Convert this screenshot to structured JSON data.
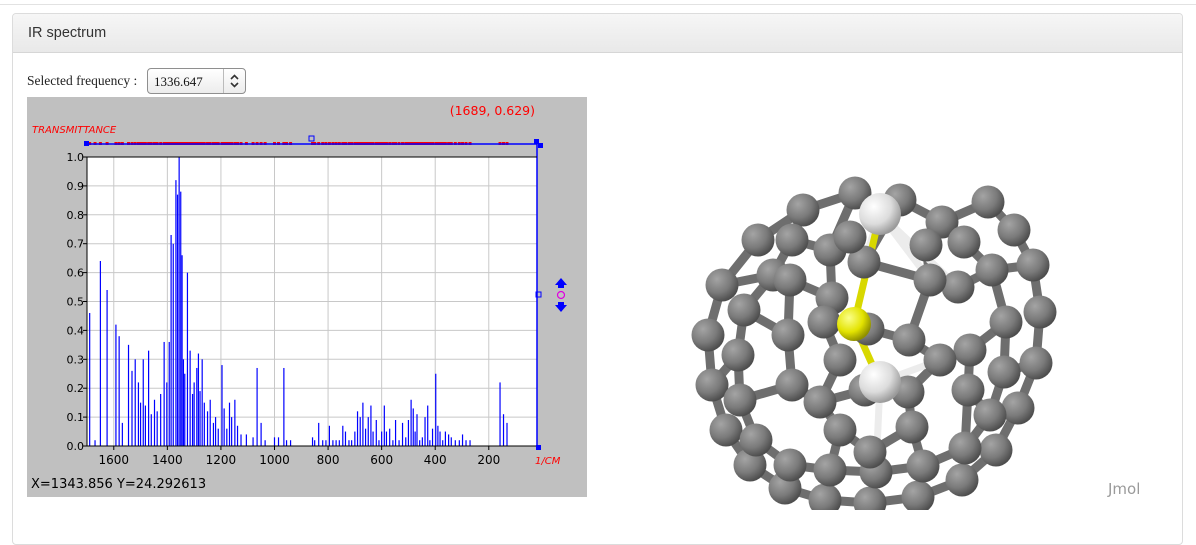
{
  "panel": {
    "title": "IR spectrum"
  },
  "frequency": {
    "label": "Selected frequency :",
    "value": "1336.647"
  },
  "spectrum": {
    "cursor_readout": "(1689, 0.629)",
    "status_readout": "X=1343.856 Y=24.292613",
    "x_unit": "1/CM",
    "y_label": "TRANSMITTANCE"
  },
  "viewer": {
    "label": "Jmol"
  },
  "icons": {
    "select_arrows": "chevron-updown-icon",
    "zoom_arrows": "zoom-updown-icon"
  },
  "colors": {
    "spectrum_line": "#0000ff",
    "peak_markers": "#ff0000",
    "plot_bg": "#c0c0c0",
    "atom_carbon": "#777777",
    "atom_sulfur": "#e0e000",
    "atom_metal": "#d8d8d8"
  },
  "chart_data": {
    "type": "bar",
    "title": "",
    "xlabel": "1/CM",
    "ylabel": "TRANSMITTANCE",
    "xlim": [
      1700,
      20
    ],
    "ylim": [
      0,
      1.0
    ],
    "grid": true,
    "x_ticks": [
      1600,
      1400,
      1200,
      1000,
      800,
      600,
      400,
      200
    ],
    "y_ticks": [
      0.0,
      0.1,
      0.2,
      0.3,
      0.4,
      0.5,
      0.6,
      0.7,
      0.8,
      0.9,
      1.0
    ],
    "x_tick_labels": [
      "1600",
      "1400",
      "1200",
      "1000",
      "800",
      "600",
      "400",
      "200"
    ],
    "y_tick_labels": [
      "0.0",
      "0.1",
      "0.2",
      "0.3",
      "0.4",
      "0.5",
      "0.6",
      "0.7",
      "0.8",
      "0.9",
      "1.0"
    ],
    "peaks": [
      {
        "x": 1690,
        "y": 0.46
      },
      {
        "x": 1670,
        "y": 0.02
      },
      {
        "x": 1650,
        "y": 0.64
      },
      {
        "x": 1625,
        "y": 0.54
      },
      {
        "x": 1592,
        "y": 0.42
      },
      {
        "x": 1580,
        "y": 0.38
      },
      {
        "x": 1568,
        "y": 0.08
      },
      {
        "x": 1545,
        "y": 0.35
      },
      {
        "x": 1532,
        "y": 0.26
      },
      {
        "x": 1520,
        "y": 0.3
      },
      {
        "x": 1508,
        "y": 0.22
      },
      {
        "x": 1500,
        "y": 0.15
      },
      {
        "x": 1490,
        "y": 0.3
      },
      {
        "x": 1482,
        "y": 0.14
      },
      {
        "x": 1470,
        "y": 0.33
      },
      {
        "x": 1460,
        "y": 0.11
      },
      {
        "x": 1448,
        "y": 0.16
      },
      {
        "x": 1438,
        "y": 0.12
      },
      {
        "x": 1425,
        "y": 0.18
      },
      {
        "x": 1412,
        "y": 0.36
      },
      {
        "x": 1402,
        "y": 0.22
      },
      {
        "x": 1393,
        "y": 0.36
      },
      {
        "x": 1386,
        "y": 0.73
      },
      {
        "x": 1378,
        "y": 0.7
      },
      {
        "x": 1368,
        "y": 0.92
      },
      {
        "x": 1362,
        "y": 0.87
      },
      {
        "x": 1356,
        "y": 1.0
      },
      {
        "x": 1350,
        "y": 0.88
      },
      {
        "x": 1345,
        "y": 0.66
      },
      {
        "x": 1340,
        "y": 0.3
      },
      {
        "x": 1335,
        "y": 0.25
      },
      {
        "x": 1325,
        "y": 0.6
      },
      {
        "x": 1315,
        "y": 0.33
      },
      {
        "x": 1306,
        "y": 0.18
      },
      {
        "x": 1300,
        "y": 0.22
      },
      {
        "x": 1290,
        "y": 0.27
      },
      {
        "x": 1284,
        "y": 0.32
      },
      {
        "x": 1278,
        "y": 0.19
      },
      {
        "x": 1270,
        "y": 0.3
      },
      {
        "x": 1262,
        "y": 0.15
      },
      {
        "x": 1250,
        "y": 0.12
      },
      {
        "x": 1240,
        "y": 0.16
      },
      {
        "x": 1228,
        "y": 0.08
      },
      {
        "x": 1220,
        "y": 0.1
      },
      {
        "x": 1210,
        "y": 0.06
      },
      {
        "x": 1196,
        "y": 0.28
      },
      {
        "x": 1188,
        "y": 0.13
      },
      {
        "x": 1178,
        "y": 0.06
      },
      {
        "x": 1168,
        "y": 0.15
      },
      {
        "x": 1160,
        "y": 0.1
      },
      {
        "x": 1148,
        "y": 0.16
      },
      {
        "x": 1138,
        "y": 0.07
      },
      {
        "x": 1125,
        "y": 0.04
      },
      {
        "x": 1105,
        "y": 0.04
      },
      {
        "x": 1080,
        "y": 0.03
      },
      {
        "x": 1065,
        "y": 0.27
      },
      {
        "x": 1050,
        "y": 0.08
      },
      {
        "x": 1035,
        "y": 0.02
      },
      {
        "x": 1000,
        "y": 0.03
      },
      {
        "x": 985,
        "y": 0.03
      },
      {
        "x": 965,
        "y": 0.27
      },
      {
        "x": 955,
        "y": 0.02
      },
      {
        "x": 940,
        "y": 0.02
      },
      {
        "x": 858,
        "y": 0.03
      },
      {
        "x": 850,
        "y": 0.02
      },
      {
        "x": 835,
        "y": 0.08
      },
      {
        "x": 820,
        "y": 0.02
      },
      {
        "x": 808,
        "y": 0.02
      },
      {
        "x": 795,
        "y": 0.07
      },
      {
        "x": 782,
        "y": 0.02
      },
      {
        "x": 770,
        "y": 0.02
      },
      {
        "x": 758,
        "y": 0.02
      },
      {
        "x": 745,
        "y": 0.07
      },
      {
        "x": 735,
        "y": 0.05
      },
      {
        "x": 722,
        "y": 0.02
      },
      {
        "x": 712,
        "y": 0.02
      },
      {
        "x": 700,
        "y": 0.05
      },
      {
        "x": 690,
        "y": 0.12
      },
      {
        "x": 680,
        "y": 0.1
      },
      {
        "x": 670,
        "y": 0.15
      },
      {
        "x": 660,
        "y": 0.06
      },
      {
        "x": 650,
        "y": 0.1
      },
      {
        "x": 640,
        "y": 0.14
      },
      {
        "x": 632,
        "y": 0.05
      },
      {
        "x": 620,
        "y": 0.09
      },
      {
        "x": 610,
        "y": 0.02
      },
      {
        "x": 600,
        "y": 0.05
      },
      {
        "x": 590,
        "y": 0.14
      },
      {
        "x": 582,
        "y": 0.05
      },
      {
        "x": 570,
        "y": 0.06
      },
      {
        "x": 558,
        "y": 0.02
      },
      {
        "x": 548,
        "y": 0.09
      },
      {
        "x": 535,
        "y": 0.02
      },
      {
        "x": 522,
        "y": 0.08
      },
      {
        "x": 510,
        "y": 0.03
      },
      {
        "x": 500,
        "y": 0.09
      },
      {
        "x": 490,
        "y": 0.16
      },
      {
        "x": 482,
        "y": 0.13
      },
      {
        "x": 475,
        "y": 0.05
      },
      {
        "x": 468,
        "y": 0.11
      },
      {
        "x": 458,
        "y": 0.02
      },
      {
        "x": 448,
        "y": 0.03
      },
      {
        "x": 438,
        "y": 0.1
      },
      {
        "x": 428,
        "y": 0.14
      },
      {
        "x": 420,
        "y": 0.02
      },
      {
        "x": 410,
        "y": 0.06
      },
      {
        "x": 398,
        "y": 0.25
      },
      {
        "x": 390,
        "y": 0.07
      },
      {
        "x": 382,
        "y": 0.05
      },
      {
        "x": 372,
        "y": 0.02
      },
      {
        "x": 362,
        "y": 0.05
      },
      {
        "x": 350,
        "y": 0.04
      },
      {
        "x": 340,
        "y": 0.03
      },
      {
        "x": 325,
        "y": 0.02
      },
      {
        "x": 310,
        "y": 0.02
      },
      {
        "x": 298,
        "y": 0.04
      },
      {
        "x": 285,
        "y": 0.02
      },
      {
        "x": 270,
        "y": 0.02
      },
      {
        "x": 158,
        "y": 0.22
      },
      {
        "x": 145,
        "y": 0.11
      },
      {
        "x": 132,
        "y": 0.08
      }
    ]
  }
}
